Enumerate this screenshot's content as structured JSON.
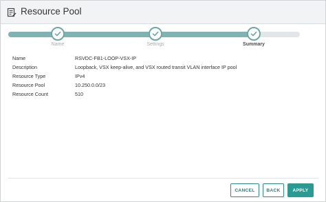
{
  "header": {
    "title": "Resource Pool",
    "icon": "edit-form-icon"
  },
  "wizard": {
    "progress_fraction": 0.84,
    "steps": [
      {
        "label": "Name",
        "state": "complete"
      },
      {
        "label": "Settings",
        "state": "complete"
      },
      {
        "label": "Summary",
        "state": "active"
      }
    ]
  },
  "summary": {
    "rows": [
      {
        "label": "Name",
        "value": "RSVDC-FB1-LOOP-VSX-IP"
      },
      {
        "label": "Description",
        "value": "Loopback, VSX keep-alive, and VSX routed transit VLAN interface IP pool"
      },
      {
        "label": "Resource Type",
        "value": "IPv4"
      },
      {
        "label": "Resource Pool",
        "value": "10.250.0.0/23"
      },
      {
        "label": "Resource Count",
        "value": "510"
      }
    ]
  },
  "buttons": {
    "cancel": "CANCEL",
    "back": "BACK",
    "apply": "APPLY"
  },
  "colors": {
    "accent": "#2b9a92",
    "progress": "#7fb3b3",
    "step_border": "#6fa7a7"
  }
}
